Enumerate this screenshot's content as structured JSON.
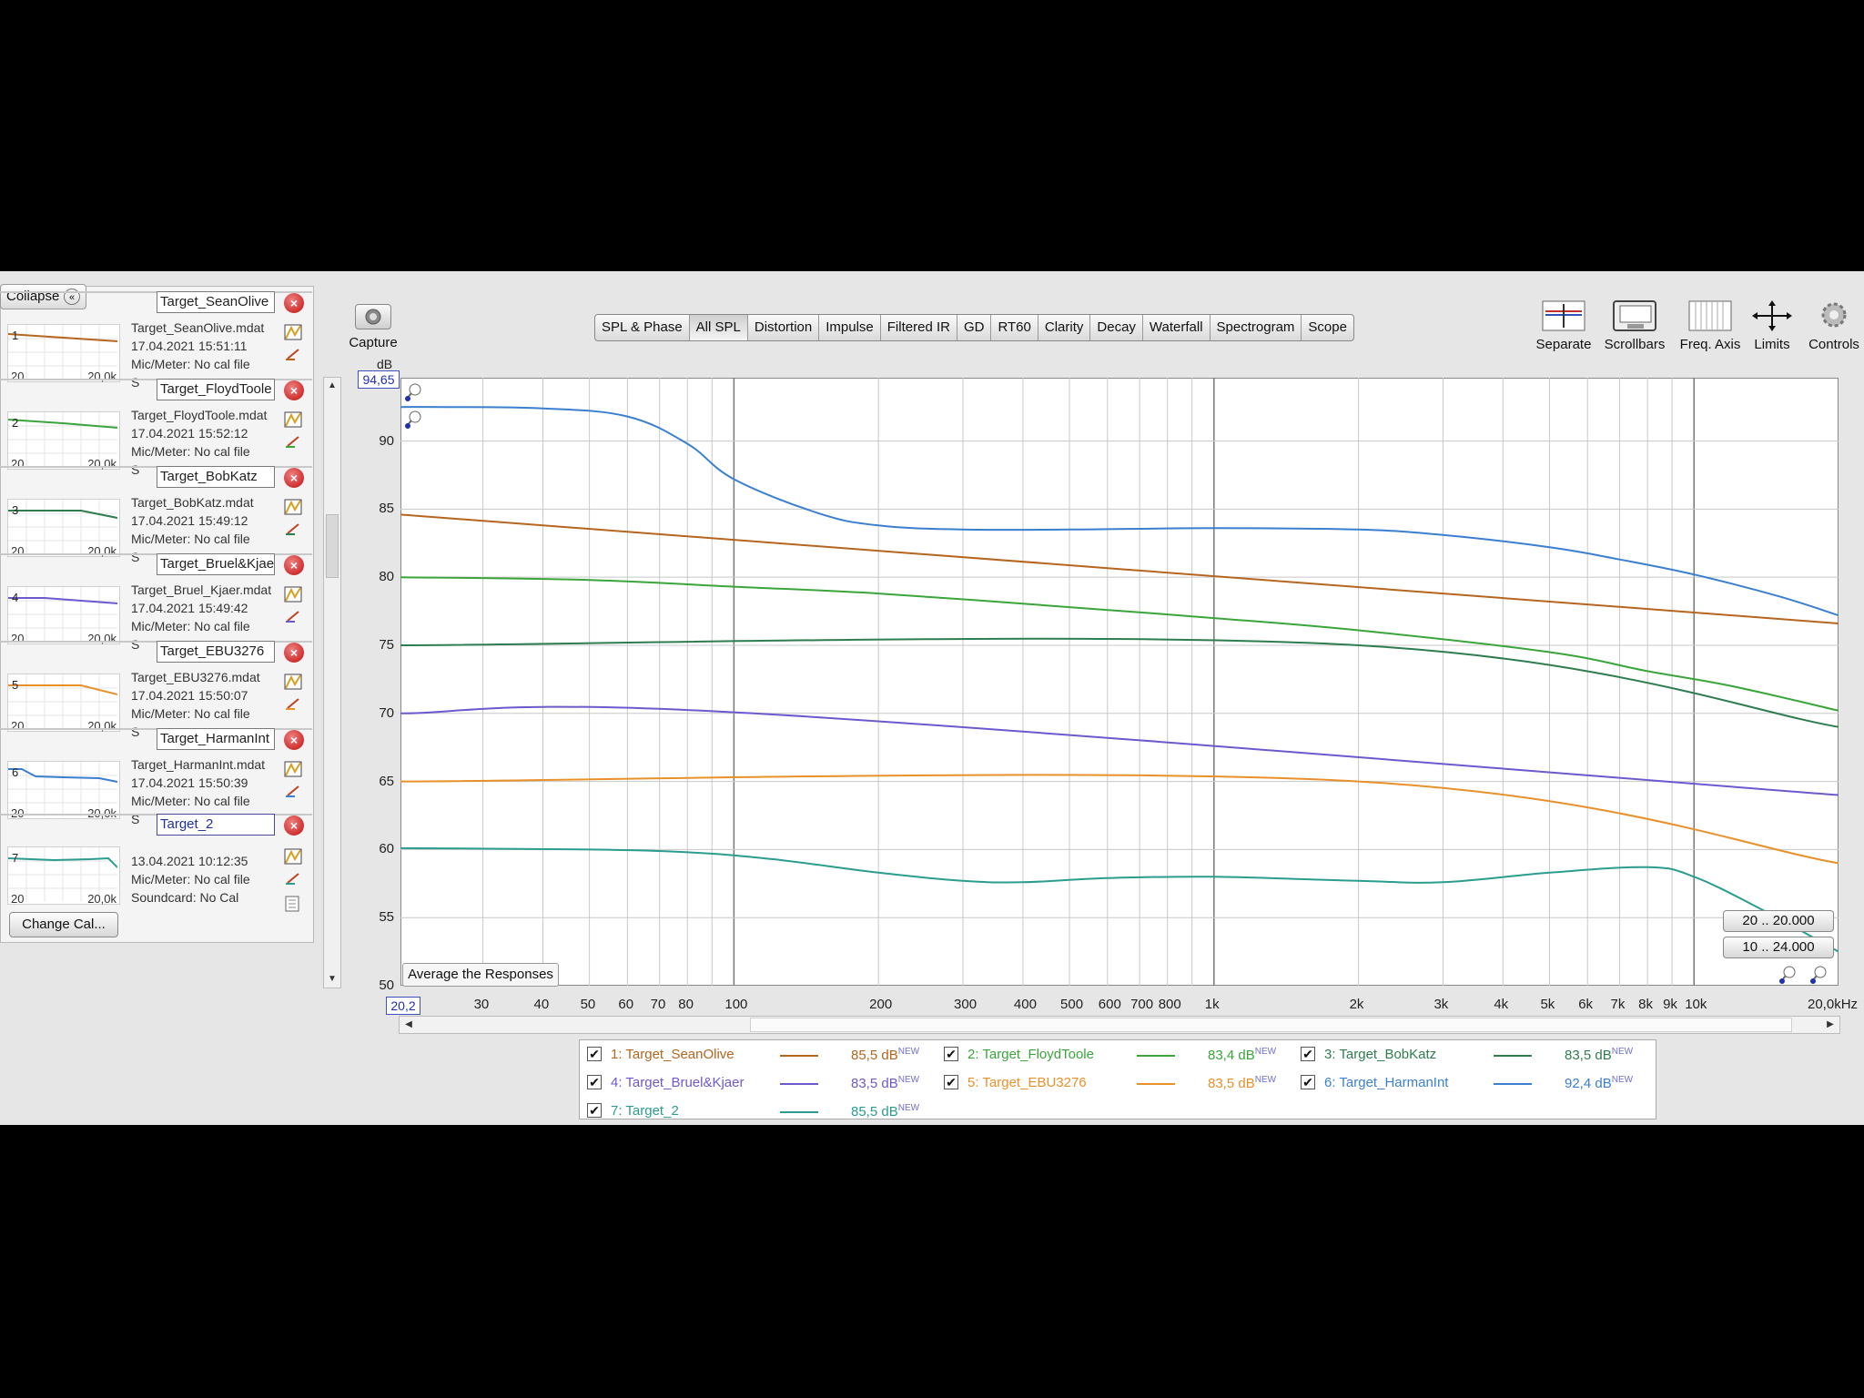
{
  "left_panel": {
    "collapse_label": "Collapse",
    "change_cal_label": "Change Cal...",
    "measurements": [
      {
        "index": "1",
        "name": "Target_SeanOlive",
        "file": "Target_SeanOlive.mdat",
        "date": "17.04.2021 15:51:11",
        "mic": "Mic/Meter: No cal file",
        "sound": "S",
        "color": "#b5651d",
        "thumb_x_min": "20",
        "thumb_x_max": "20,0k"
      },
      {
        "index": "2",
        "name": "Target_FloydToole",
        "file": "Target_FloydToole.mdat",
        "date": "17.04.2021 15:52:12",
        "mic": "Mic/Meter: No cal file",
        "sound": "S",
        "color": "#3aa53a",
        "thumb_x_min": "20",
        "thumb_x_max": "20,0k"
      },
      {
        "index": "3",
        "name": "Target_BobKatz",
        "file": "Target_BobKatz.mdat",
        "date": "17.04.2021 15:49:12",
        "mic": "Mic/Meter: No cal file",
        "sound": "S",
        "color": "#2e7d4f",
        "thumb_x_min": "20",
        "thumb_x_max": "20,0k"
      },
      {
        "index": "4",
        "name": "Target_Bruel&Kjaer",
        "file": "Target_Bruel_Kjaer.mdat",
        "date": "17.04.2021 15:49:42",
        "mic": "Mic/Meter: No cal file",
        "sound": "S",
        "color": "#6a5acd",
        "thumb_x_min": "20",
        "thumb_x_max": "20,0k"
      },
      {
        "index": "5",
        "name": "Target_EBU3276",
        "file": "Target_EBU3276.mdat",
        "date": "17.04.2021 15:50:07",
        "mic": "Mic/Meter: No cal file",
        "sound": "S",
        "color": "#e8902a",
        "thumb_x_min": "20",
        "thumb_x_max": "20,0k"
      },
      {
        "index": "6",
        "name": "Target_HarmanInt",
        "file": "Target_HarmanInt.mdat",
        "date": "17.04.2021 15:50:39",
        "mic": "Mic/Meter: No cal file",
        "sound": "S",
        "color": "#3a7fd0",
        "thumb_x_min": "20",
        "thumb_x_max": "20,0k"
      },
      {
        "index": "7",
        "name": "Target_2",
        "file": "",
        "date": "13.04.2021 10:12:35",
        "mic": "Mic/Meter: No cal file",
        "sound": "Soundcard: No Cal",
        "color": "#2a9d8f",
        "thumb_x_min": "20",
        "thumb_x_max": "20,0k"
      }
    ]
  },
  "toolbar": {
    "capture_label": "Capture",
    "tabs": [
      "SPL & Phase",
      "All SPL",
      "Distortion",
      "Impulse",
      "Filtered IR",
      "GD",
      "RT60",
      "Clarity",
      "Decay",
      "Waterfall",
      "Spectrogram",
      "Scope"
    ],
    "active_tab": "All SPL",
    "right_tools": [
      "Separate",
      "Scrollbars",
      "Freq. Axis",
      "Limits",
      "Controls"
    ]
  },
  "graph": {
    "y_unit": "dB",
    "y_top_value": "94,65",
    "x_left_value": "20,2",
    "average_button": "Average the Responses",
    "range_buttons": [
      "20 .. 20.000",
      "10 .. 24.000"
    ],
    "y_ticks": [
      "90",
      "85",
      "80",
      "75",
      "70",
      "65",
      "60",
      "55",
      "50"
    ],
    "x_ticks": [
      "30",
      "40",
      "50",
      "60",
      "70",
      "80",
      "100",
      "200",
      "300",
      "400",
      "500",
      "600",
      "700",
      "800",
      "1k",
      "2k",
      "3k",
      "4k",
      "5k",
      "6k",
      "7k",
      "8k",
      "9k",
      "10k",
      "20,0kHz"
    ]
  },
  "chart_data": {
    "type": "line",
    "xscale": "log",
    "xlim": [
      20.2,
      20000
    ],
    "ylim": [
      50,
      94.65
    ],
    "xlabel": "",
    "ylabel": "dB",
    "grid": true,
    "series": [
      {
        "name": "1: Target_SeanOlive",
        "color": "#b5651d",
        "x": [
          20.2,
          20000
        ],
        "y": [
          84.6,
          76.6
        ]
      },
      {
        "name": "2: Target_FloydToole",
        "color": "#3aa53a",
        "x": [
          20.2,
          50,
          100,
          200,
          500,
          1000,
          2000,
          5000,
          8000,
          12000,
          20000
        ],
        "y": [
          80,
          79.8,
          79.3,
          78.8,
          77.8,
          77,
          76.1,
          74.5,
          73.1,
          72,
          70.2
        ]
      },
      {
        "name": "3: Target_BobKatz",
        "color": "#2e7d4f",
        "x": [
          20.2,
          2000,
          20000
        ],
        "y": [
          75,
          75,
          69
        ]
      },
      {
        "name": "4: Target_Bruel&Kjaer",
        "color": "#6a5acd",
        "x": [
          20.2,
          110,
          20000
        ],
        "y": [
          70,
          70,
          64
        ]
      },
      {
        "name": "5: Target_EBU3276",
        "color": "#e8902a",
        "x": [
          20.2,
          2000,
          20000
        ],
        "y": [
          65,
          65,
          59
        ]
      },
      {
        "name": "6: Target_HarmanInt",
        "color": "#3a7fd0",
        "x": [
          20.2,
          25,
          40,
          60,
          80,
          100,
          150,
          200,
          300,
          500,
          1000,
          2000,
          3000,
          5000,
          7000,
          10000,
          15000,
          20000
        ],
        "y": [
          92.5,
          92.5,
          92.4,
          91.8,
          89.8,
          87.2,
          84.7,
          83.8,
          83.5,
          83.5,
          83.6,
          83.5,
          83.1,
          82.2,
          81.3,
          80.2,
          78.6,
          77.2
        ]
      },
      {
        "name": "7: Target_2",
        "color": "#2a9d8f",
        "x": [
          20.2,
          50,
          80,
          120,
          200,
          300,
          400,
          600,
          1000,
          2000,
          3000,
          5000,
          8000,
          10000,
          14000,
          20000
        ],
        "y": [
          60.1,
          60,
          59.8,
          59.3,
          58.3,
          57.7,
          57.6,
          57.9,
          58,
          57.7,
          57.6,
          58.3,
          58.7,
          58,
          55.5,
          52.5
        ]
      }
    ]
  },
  "legend": [
    {
      "label": "1: Target_SeanOlive",
      "value": "85,5 dB",
      "new": "NEW",
      "color": "#b5651d"
    },
    {
      "label": "2: Target_FloydToole",
      "value": "83,4 dB",
      "new": "NEW",
      "color": "#3aa53a"
    },
    {
      "label": "3: Target_BobKatz",
      "value": "83,5 dB",
      "new": "NEW",
      "color": "#2e7d4f"
    },
    {
      "label": "4: Target_Bruel&Kjaer",
      "value": "83,5 dB",
      "new": "NEW",
      "color": "#6a5acd"
    },
    {
      "label": "5: Target_EBU3276",
      "value": "83,5 dB",
      "new": "NEW",
      "color": "#e8902a"
    },
    {
      "label": "6: Target_HarmanInt",
      "value": "92,4 dB",
      "new": "NEW",
      "color": "#3a7fd0"
    },
    {
      "label": "7: Target_2",
      "value": "85,5 dB",
      "new": "NEW",
      "color": "#2a9d8f"
    }
  ]
}
